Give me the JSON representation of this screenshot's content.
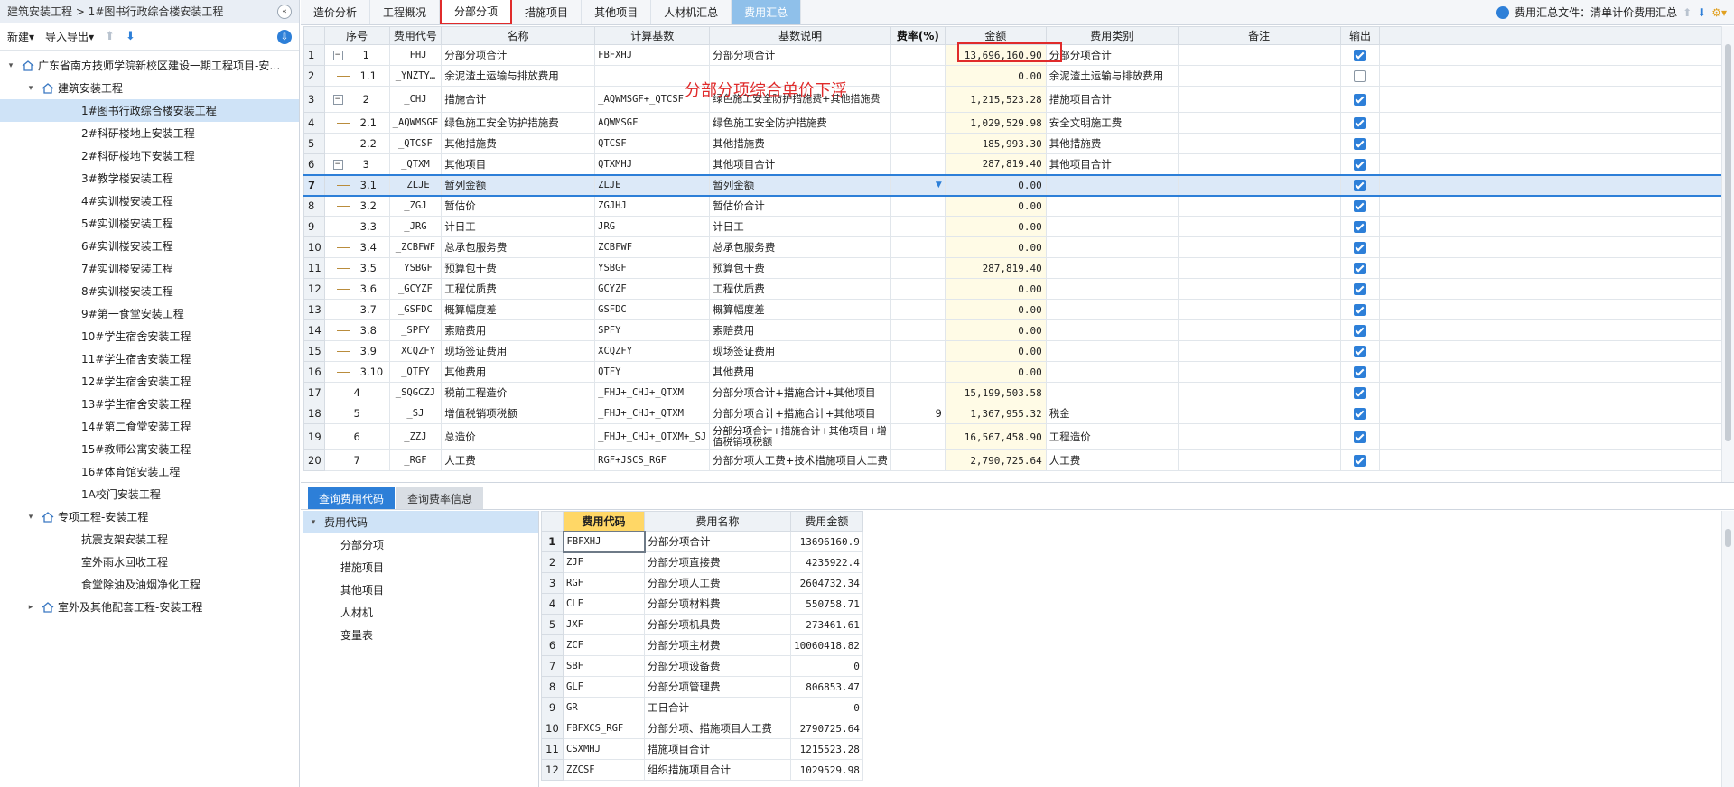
{
  "breadcrumb": "建筑安装工程 > 1#图书行政综合楼安装工程",
  "left_toolbar": {
    "new_label": "新建",
    "import_export_label": "导入导出"
  },
  "tree": [
    {
      "label": "广东省南方技师学院新校区建设一期工程项目-安…",
      "level": 0,
      "toggle": "▾",
      "icon": "house"
    },
    {
      "label": "建筑安装工程",
      "level": 1,
      "toggle": "▾",
      "icon": "house"
    },
    {
      "label": "1#图书行政综合楼安装工程",
      "level": 2,
      "selected": true
    },
    {
      "label": "2#科研楼地上安装工程",
      "level": 2
    },
    {
      "label": "2#科研楼地下安装工程",
      "level": 2
    },
    {
      "label": "3#教学楼安装工程",
      "level": 2
    },
    {
      "label": "4#实训楼安装工程",
      "level": 2
    },
    {
      "label": "5#实训楼安装工程",
      "level": 2
    },
    {
      "label": "6#实训楼安装工程",
      "level": 2
    },
    {
      "label": "7#实训楼安装工程",
      "level": 2
    },
    {
      "label": "8#实训楼安装工程",
      "level": 2
    },
    {
      "label": "9#第一食堂安装工程",
      "level": 2
    },
    {
      "label": "10#学生宿舍安装工程",
      "level": 2
    },
    {
      "label": "11#学生宿舍安装工程",
      "level": 2
    },
    {
      "label": "12#学生宿舍安装工程",
      "level": 2
    },
    {
      "label": "13#学生宿舍安装工程",
      "level": 2
    },
    {
      "label": "14#第二食堂安装工程",
      "level": 2
    },
    {
      "label": "15#教师公寓安装工程",
      "level": 2
    },
    {
      "label": "16#体育馆安装工程",
      "level": 2
    },
    {
      "label": "1A校门安装工程",
      "level": 2
    },
    {
      "label": "专项工程-安装工程",
      "level": 1,
      "toggle": "▾",
      "icon": "house"
    },
    {
      "label": "抗震支架安装工程",
      "level": 2
    },
    {
      "label": "室外雨水回收工程",
      "level": 2
    },
    {
      "label": "食堂除油及油烟净化工程",
      "level": 2
    },
    {
      "label": "室外及其他配套工程-安装工程",
      "level": 1,
      "toggle": "▸",
      "icon": "house"
    }
  ],
  "tabs": [
    "造价分析",
    "工程概况",
    "分部分项",
    "措施项目",
    "其他项目",
    "人材机汇总",
    "费用汇总"
  ],
  "tabs_right_label": "费用汇总文件：清单计价费用汇总",
  "annotation": "分部分项综合单价下浮",
  "grid": {
    "headers": [
      "",
      "序号",
      "费用代号",
      "名称",
      "计算基数",
      "基数说明",
      "费率(%)",
      "金额",
      "费用类别",
      "备注",
      "输出"
    ],
    "rows": [
      {
        "rn": "1",
        "seq": "1",
        "code": "_FHJ",
        "name": "分部分项合计",
        "base": "FBFXHJ",
        "desc": "分部分项合计",
        "rate": "",
        "amount": "13,696,160.90",
        "cat": "分部分项合计",
        "note": "",
        "out": true,
        "tree": "minus"
      },
      {
        "rn": "2",
        "seq": "1.1",
        "code": "_YNZTY…",
        "name": "余泥渣土运输与排放费用",
        "base": "",
        "desc": "",
        "rate": "",
        "amount": "0.00",
        "cat": "余泥渣土运输与排放费用",
        "note": "",
        "out": false,
        "tree": "line"
      },
      {
        "rn": "3",
        "seq": "2",
        "code": "_CHJ",
        "name": "措施合计",
        "base": "_AQWMSGF+_QTCSF",
        "desc": "绿色施工安全防护措施费+其他措施费",
        "rate": "",
        "amount": "1,215,523.28",
        "cat": "措施项目合计",
        "note": "",
        "out": true,
        "tree": "minus",
        "tall": true
      },
      {
        "rn": "4",
        "seq": "2.1",
        "code": "_AQWMSGF",
        "name": "绿色施工安全防护措施费",
        "base": "AQWMSGF",
        "desc": "绿色施工安全防护措施费",
        "rate": "",
        "amount": "1,029,529.98",
        "cat": "安全文明施工费",
        "note": "",
        "out": true,
        "tree": "line"
      },
      {
        "rn": "5",
        "seq": "2.2",
        "code": "_QTCSF",
        "name": "其他措施费",
        "base": "QTCSF",
        "desc": "其他措施费",
        "rate": "",
        "amount": "185,993.30",
        "cat": "其他措施费",
        "note": "",
        "out": true,
        "tree": "line"
      },
      {
        "rn": "6",
        "seq": "3",
        "code": "_QTXM",
        "name": "其他项目",
        "base": "QTXMHJ",
        "desc": "其他项目合计",
        "rate": "",
        "amount": "287,819.40",
        "cat": "其他项目合计",
        "note": "",
        "out": true,
        "tree": "minus"
      },
      {
        "rn": "7",
        "seq": "3.1",
        "code": "_ZLJE",
        "name": "暂列金额",
        "base": "ZLJE",
        "desc": "暂列金额",
        "rate": "",
        "amount": "0.00",
        "cat": "",
        "note": "",
        "out": true,
        "tree": "line",
        "selected": true
      },
      {
        "rn": "8",
        "seq": "3.2",
        "code": "_ZGJ",
        "name": "暂估价",
        "base": "ZGJHJ",
        "desc": "暂估价合计",
        "rate": "",
        "amount": "0.00",
        "cat": "",
        "note": "",
        "out": true,
        "tree": "line"
      },
      {
        "rn": "9",
        "seq": "3.3",
        "code": "_JRG",
        "name": "计日工",
        "base": "JRG",
        "desc": "计日工",
        "rate": "",
        "amount": "0.00",
        "cat": "",
        "note": "",
        "out": true,
        "tree": "line"
      },
      {
        "rn": "10",
        "seq": "3.4",
        "code": "_ZCBFWF",
        "name": "总承包服务费",
        "base": "ZCBFWF",
        "desc": "总承包服务费",
        "rate": "",
        "amount": "0.00",
        "cat": "",
        "note": "",
        "out": true,
        "tree": "line"
      },
      {
        "rn": "11",
        "seq": "3.5",
        "code": "_YSBGF",
        "name": "预算包干费",
        "base": "YSBGF",
        "desc": "预算包干费",
        "rate": "",
        "amount": "287,819.40",
        "cat": "",
        "note": "",
        "out": true,
        "tree": "line"
      },
      {
        "rn": "12",
        "seq": "3.6",
        "code": "_GCYZF",
        "name": "工程优质费",
        "base": "GCYZF",
        "desc": "工程优质费",
        "rate": "",
        "amount": "0.00",
        "cat": "",
        "note": "",
        "out": true,
        "tree": "line"
      },
      {
        "rn": "13",
        "seq": "3.7",
        "code": "_GSFDC",
        "name": "概算幅度差",
        "base": "GSFDC",
        "desc": "概算幅度差",
        "rate": "",
        "amount": "0.00",
        "cat": "",
        "note": "",
        "out": true,
        "tree": "line"
      },
      {
        "rn": "14",
        "seq": "3.8",
        "code": "_SPFY",
        "name": "索赔费用",
        "base": "SPFY",
        "desc": "索赔费用",
        "rate": "",
        "amount": "0.00",
        "cat": "",
        "note": "",
        "out": true,
        "tree": "line"
      },
      {
        "rn": "15",
        "seq": "3.9",
        "code": "_XCQZFY",
        "name": "现场签证费用",
        "base": "XCQZFY",
        "desc": "现场签证费用",
        "rate": "",
        "amount": "0.00",
        "cat": "",
        "note": "",
        "out": true,
        "tree": "line"
      },
      {
        "rn": "16",
        "seq": "3.10",
        "code": "_QTFY",
        "name": "其他费用",
        "base": "QTFY",
        "desc": "其他费用",
        "rate": "",
        "amount": "0.00",
        "cat": "",
        "note": "",
        "out": true,
        "tree": "line"
      },
      {
        "rn": "17",
        "seq": "4",
        "code": "_SQGCZJ",
        "name": "税前工程造价",
        "base": "_FHJ+_CHJ+_QTXM",
        "desc": "分部分项合计+措施合计+其他项目",
        "rate": "",
        "amount": "15,199,503.58",
        "cat": "",
        "note": "",
        "out": true,
        "tree": "none"
      },
      {
        "rn": "18",
        "seq": "5",
        "code": "_SJ",
        "name": "增值税销项税额",
        "base": "_FHJ+_CHJ+_QTXM",
        "desc": "分部分项合计+措施合计+其他项目",
        "rate": "9",
        "amount": "1,367,955.32",
        "cat": "税金",
        "note": "",
        "out": true,
        "tree": "none"
      },
      {
        "rn": "19",
        "seq": "6",
        "code": "_ZZJ",
        "name": "总造价",
        "base": "_FHJ+_CHJ+_QTXM+_SJ",
        "desc": "分部分项合计+措施合计+其他项目+增值税销项税额",
        "rate": "",
        "amount": "16,567,458.90",
        "cat": "工程造价",
        "note": "",
        "out": true,
        "tree": "none",
        "tall": true
      },
      {
        "rn": "20",
        "seq": "7",
        "code": "_RGF",
        "name": "人工费",
        "base": "RGF+JSCS_RGF",
        "desc": "分部分项人工费+技术措施项目人工费",
        "rate": "",
        "amount": "2,790,725.64",
        "cat": "人工费",
        "note": "",
        "out": true,
        "tree": "none"
      }
    ]
  },
  "bottom": {
    "tabs": [
      "查询费用代码",
      "查询费率信息"
    ],
    "categories": [
      "费用代码",
      "分部分项",
      "措施项目",
      "其他项目",
      "人材机",
      "变量表"
    ],
    "headers": [
      "",
      "费用代码",
      "费用名称",
      "费用金额"
    ],
    "rows": [
      {
        "rn": "1",
        "code": "FBFXHJ",
        "name": "分部分项合计",
        "amount": "13696160.9"
      },
      {
        "rn": "2",
        "code": "ZJF",
        "name": "分部分项直接费",
        "amount": "4235922.4"
      },
      {
        "rn": "3",
        "code": "RGF",
        "name": "分部分项人工费",
        "amount": "2604732.34"
      },
      {
        "rn": "4",
        "code": "CLF",
        "name": "分部分项材料费",
        "amount": "550758.71"
      },
      {
        "rn": "5",
        "code": "JXF",
        "name": "分部分项机具费",
        "amount": "273461.61"
      },
      {
        "rn": "6",
        "code": "ZCF",
        "name": "分部分项主材费",
        "amount": "10060418.82"
      },
      {
        "rn": "7",
        "code": "SBF",
        "name": "分部分项设备费",
        "amount": "0"
      },
      {
        "rn": "8",
        "code": "GLF",
        "name": "分部分项管理费",
        "amount": "806853.47"
      },
      {
        "rn": "9",
        "code": "GR",
        "name": "工日合计",
        "amount": "0"
      },
      {
        "rn": "10",
        "code": "FBFXCS_RGF",
        "name": "分部分项、措施项目人工费",
        "amount": "2790725.64"
      },
      {
        "rn": "11",
        "code": "CSXMHJ",
        "name": "措施项目合计",
        "amount": "1215523.28"
      },
      {
        "rn": "12",
        "code": "ZZCSF",
        "name": "组织措施项目合计",
        "amount": "1029529.98"
      }
    ]
  }
}
